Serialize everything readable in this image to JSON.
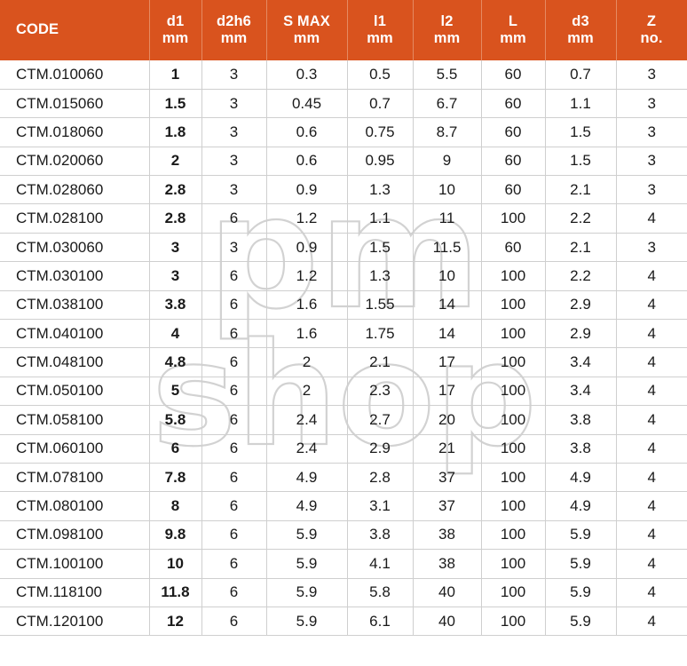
{
  "table": {
    "columns": [
      {
        "name": "CODE",
        "unit": "",
        "key": "code"
      },
      {
        "name": "d1",
        "unit": "mm",
        "key": "d1"
      },
      {
        "name": "d2h6",
        "unit": "mm",
        "key": "d2h6"
      },
      {
        "name": "S MAX",
        "unit": "mm",
        "key": "s_max"
      },
      {
        "name": "l1",
        "unit": "mm",
        "key": "l1"
      },
      {
        "name": "l2",
        "unit": "mm",
        "key": "l2"
      },
      {
        "name": "L",
        "unit": "mm",
        "key": "L"
      },
      {
        "name": "d3",
        "unit": "mm",
        "key": "d3"
      },
      {
        "name": "Z",
        "unit": "no.",
        "key": "Z"
      }
    ],
    "header_background": "#d9531e",
    "header_text_color": "#ffffff",
    "rows": [
      {
        "code": "CTM.010060",
        "d1": "1",
        "d2h6": "3",
        "s_max": "0.3",
        "l1": "0.5",
        "l2": "5.5",
        "L": "60",
        "d3": "0.7",
        "Z": "3"
      },
      {
        "code": "CTM.015060",
        "d1": "1.5",
        "d2h6": "3",
        "s_max": "0.45",
        "l1": "0.7",
        "l2": "6.7",
        "L": "60",
        "d3": "1.1",
        "Z": "3"
      },
      {
        "code": "CTM.018060",
        "d1": "1.8",
        "d2h6": "3",
        "s_max": "0.6",
        "l1": "0.75",
        "l2": "8.7",
        "L": "60",
        "d3": "1.5",
        "Z": "3"
      },
      {
        "code": "CTM.020060",
        "d1": "2",
        "d2h6": "3",
        "s_max": "0.6",
        "l1": "0.95",
        "l2": "9",
        "L": "60",
        "d3": "1.5",
        "Z": "3"
      },
      {
        "code": "CTM.028060",
        "d1": "2.8",
        "d2h6": "3",
        "s_max": "0.9",
        "l1": "1.3",
        "l2": "10",
        "L": "60",
        "d3": "2.1",
        "Z": "3"
      },
      {
        "code": "CTM.028100",
        "d1": "2.8",
        "d2h6": "6",
        "s_max": "1.2",
        "l1": "1.1",
        "l2": "11",
        "L": "100",
        "d3": "2.2",
        "Z": "4"
      },
      {
        "code": "CTM.030060",
        "d1": "3",
        "d2h6": "3",
        "s_max": "0.9",
        "l1": "1.5",
        "l2": "11.5",
        "L": "60",
        "d3": "2.1",
        "Z": "3"
      },
      {
        "code": "CTM.030100",
        "d1": "3",
        "d2h6": "6",
        "s_max": "1.2",
        "l1": "1.3",
        "l2": "10",
        "L": "100",
        "d3": "2.2",
        "Z": "4"
      },
      {
        "code": "CTM.038100",
        "d1": "3.8",
        "d2h6": "6",
        "s_max": "1.6",
        "l1": "1.55",
        "l2": "14",
        "L": "100",
        "d3": "2.9",
        "Z": "4"
      },
      {
        "code": "CTM.040100",
        "d1": "4",
        "d2h6": "6",
        "s_max": "1.6",
        "l1": "1.75",
        "l2": "14",
        "L": "100",
        "d3": "2.9",
        "Z": "4"
      },
      {
        "code": "CTM.048100",
        "d1": "4.8",
        "d2h6": "6",
        "s_max": "2",
        "l1": "2.1",
        "l2": "17",
        "L": "100",
        "d3": "3.4",
        "Z": "4"
      },
      {
        "code": "CTM.050100",
        "d1": "5",
        "d2h6": "6",
        "s_max": "2",
        "l1": "2.3",
        "l2": "17",
        "L": "100",
        "d3": "3.4",
        "Z": "4"
      },
      {
        "code": "CTM.058100",
        "d1": "5.8",
        "d2h6": "6",
        "s_max": "2.4",
        "l1": "2.7",
        "l2": "20",
        "L": "100",
        "d3": "3.8",
        "Z": "4"
      },
      {
        "code": "CTM.060100",
        "d1": "6",
        "d2h6": "6",
        "s_max": "2.4",
        "l1": "2.9",
        "l2": "21",
        "L": "100",
        "d3": "3.8",
        "Z": "4"
      },
      {
        "code": "CTM.078100",
        "d1": "7.8",
        "d2h6": "6",
        "s_max": "4.9",
        "l1": "2.8",
        "l2": "37",
        "L": "100",
        "d3": "4.9",
        "Z": "4"
      },
      {
        "code": "CTM.080100",
        "d1": "8",
        "d2h6": "6",
        "s_max": "4.9",
        "l1": "3.1",
        "l2": "37",
        "L": "100",
        "d3": "4.9",
        "Z": "4"
      },
      {
        "code": "CTM.098100",
        "d1": "9.8",
        "d2h6": "6",
        "s_max": "5.9",
        "l1": "3.8",
        "l2": "38",
        "L": "100",
        "d3": "5.9",
        "Z": "4"
      },
      {
        "code": "CTM.100100",
        "d1": "10",
        "d2h6": "6",
        "s_max": "5.9",
        "l1": "4.1",
        "l2": "38",
        "L": "100",
        "d3": "5.9",
        "Z": "4"
      },
      {
        "code": "CTM.118100",
        "d1": "11.8",
        "d2h6": "6",
        "s_max": "5.9",
        "l1": "5.8",
        "l2": "40",
        "L": "100",
        "d3": "5.9",
        "Z": "4"
      },
      {
        "code": "CTM.120100",
        "d1": "12",
        "d2h6": "6",
        "s_max": "5.9",
        "l1": "6.1",
        "l2": "40",
        "L": "100",
        "d3": "5.9",
        "Z": "4"
      }
    ]
  },
  "watermark": {
    "line1": "pm",
    "line2": "shop",
    "color": "#d2d2d2"
  }
}
